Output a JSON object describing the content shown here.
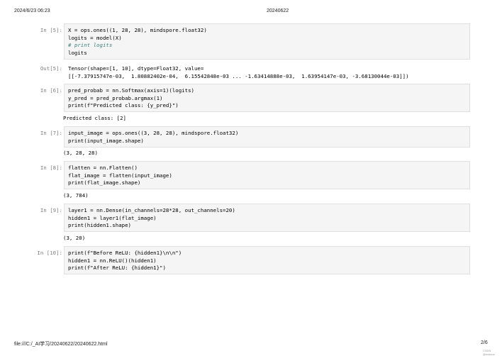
{
  "header": {
    "datetime": "2024/6/23 06:23",
    "title": "20240622"
  },
  "footer": {
    "path": "file:///C:/_AI学习/20240622/20240622.html",
    "page": "2/6"
  },
  "watermark": "CSDN @mxiaox",
  "cells": [
    {
      "prompt_in": "In [5]:",
      "code": [
        "X = ops.ones((1, 28, 28), mindspore.float32)",
        "logits = model(X)",
        "# print logits",
        "logits"
      ],
      "prompt_out": "Out[5]:",
      "output": [
        "Tensor(shape=[1, 10], dtype=Float32, value=",
        "[[-7.37915747e-03,  1.80882402e-04,  6.15542848e-03 ... -1.63414888e-03,  1.63954147e-03, -3.68130044e-03]])"
      ]
    },
    {
      "prompt_in": "In [6]:",
      "code": [
        "pred_probab = nn.Softmax(axis=1)(logits)",
        "y_pred = pred_probab.argmax(1)",
        "print(f\"Predicted class: {y_pred}\")"
      ],
      "output": [
        "Predicted class: [2]"
      ]
    },
    {
      "prompt_in": "In [7]:",
      "code": [
        "input_image = ops.ones((3, 28, 28), mindspore.float32)",
        "print(input_image.shape)"
      ],
      "output": [
        "(3, 28, 28)"
      ]
    },
    {
      "prompt_in": "In [8]:",
      "code": [
        "flatten = nn.Flatten()",
        "flat_image = flatten(input_image)",
        "print(flat_image.shape)"
      ],
      "output": [
        "(3, 784)"
      ]
    },
    {
      "prompt_in": "In [9]:",
      "code": [
        "layer1 = nn.Dense(in_channels=28*28, out_channels=20)",
        "hidden1 = layer1(flat_image)",
        "print(hidden1.shape)"
      ],
      "output": [
        "(3, 20)"
      ]
    },
    {
      "prompt_in": "In [10]:",
      "code": [
        "print(f\"Before ReLU: {hidden1}\\n\\n\")",
        "hidden1 = nn.ReLU()(hidden1)",
        "print(f\"After ReLU: {hidden1}\")"
      ]
    }
  ]
}
